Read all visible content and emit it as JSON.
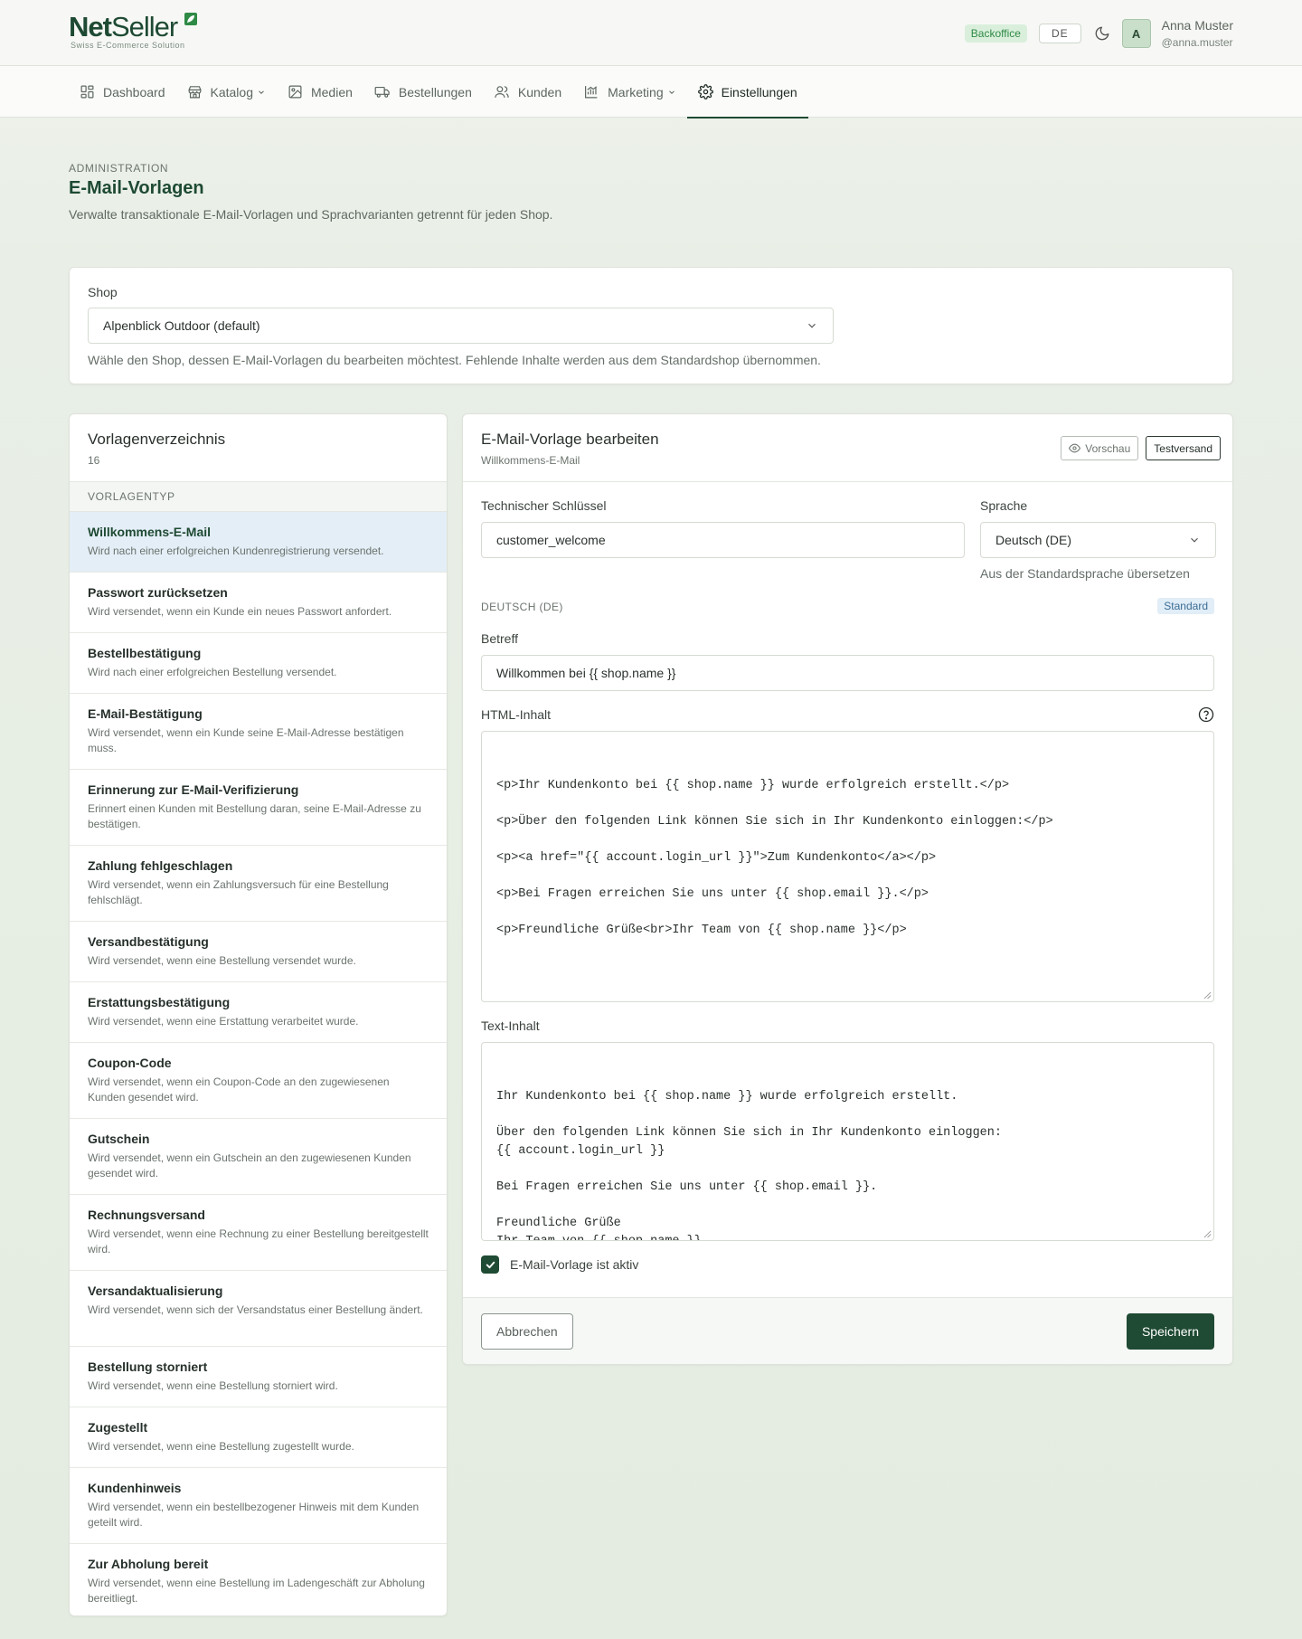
{
  "brand": {
    "name_bold": "Net",
    "name_light": "Seller",
    "tagline": "Swiss E-Commerce Solution"
  },
  "header": {
    "badge": "Backoffice",
    "language": "DE",
    "user": {
      "initial": "A",
      "name": "Anna Muster",
      "handle": "@anna.muster"
    }
  },
  "nav": {
    "items": [
      {
        "label": "Dashboard",
        "icon": "dashboard-icon",
        "dropdown": false,
        "active": false
      },
      {
        "label": "Katalog",
        "icon": "store-icon",
        "dropdown": true,
        "active": false
      },
      {
        "label": "Medien",
        "icon": "image-icon",
        "dropdown": false,
        "active": false
      },
      {
        "label": "Bestellungen",
        "icon": "truck-icon",
        "dropdown": false,
        "active": false
      },
      {
        "label": "Kunden",
        "icon": "users-icon",
        "dropdown": false,
        "active": false
      },
      {
        "label": "Marketing",
        "icon": "chart-icon",
        "dropdown": true,
        "active": false
      },
      {
        "label": "Einstellungen",
        "icon": "gear-icon",
        "dropdown": false,
        "active": true
      }
    ]
  },
  "page": {
    "eyebrow": "ADMINISTRATION",
    "title": "E-Mail-Vorlagen",
    "description": "Verwalte transaktionale E-Mail-Vorlagen und Sprachvarianten getrennt für jeden Shop."
  },
  "shop": {
    "label": "Shop",
    "value": "Alpenblick Outdoor (default)",
    "help": "Wähle den Shop, dessen E-Mail-Vorlagen du bearbeiten möchtest. Fehlende Inhalte werden aus dem Standardshop übernommen."
  },
  "templates": {
    "title": "Vorlagenverzeichnis",
    "count": "16",
    "column": "VORLAGENTYP",
    "items": [
      {
        "name": "Willkommens-E-Mail",
        "desc": "Wird nach einer erfolgreichen Kundenregistrierung versendet.",
        "active": true
      },
      {
        "name": "Passwort zurücksetzen",
        "desc": "Wird versendet, wenn ein Kunde ein neues Passwort anfordert.",
        "active": false
      },
      {
        "name": "Bestellbestätigung",
        "desc": "Wird nach einer erfolgreichen Bestellung versendet.",
        "active": false
      },
      {
        "name": "E-Mail-Bestätigung",
        "desc": "Wird versendet, wenn ein Kunde seine E-Mail-Adresse bestätigen muss.",
        "active": false
      },
      {
        "name": "Erinnerung zur E-Mail-Verifizierung",
        "desc": "Erinnert einen Kunden mit Bestellung daran, seine E-Mail-Adresse zu bestätigen.",
        "active": false
      },
      {
        "name": "Zahlung fehlgeschlagen",
        "desc": "Wird versendet, wenn ein Zahlungsversuch für eine Bestellung fehlschlägt.",
        "active": false
      },
      {
        "name": "Versandbestätigung",
        "desc": "Wird versendet, wenn eine Bestellung versendet wurde.",
        "active": false
      },
      {
        "name": "Erstattungsbestätigung",
        "desc": "Wird versendet, wenn eine Erstattung verarbeitet wurde.",
        "active": false
      },
      {
        "name": "Coupon-Code",
        "desc": "Wird versendet, wenn ein Coupon-Code an den zugewiesenen Kunden gesendet wird.",
        "active": false
      },
      {
        "name": "Gutschein",
        "desc": "Wird versendet, wenn ein Gutschein an den zugewiesenen Kunden gesendet wird.",
        "active": false
      },
      {
        "name": "Rechnungsversand",
        "desc": "Wird versendet, wenn eine Rechnung zu einer Bestellung bereitgestellt wird.",
        "active": false
      },
      {
        "name": "Versandaktualisierung",
        "desc": "Wird versendet, wenn sich der Versandstatus einer Bestellung ändert.",
        "active": false
      },
      {
        "name": "Bestellung storniert",
        "desc": "Wird versendet, wenn eine Bestellung storniert wird.",
        "active": false
      },
      {
        "name": "Zugestellt",
        "desc": "Wird versendet, wenn eine Bestellung zugestellt wurde.",
        "active": false
      },
      {
        "name": "Kundenhinweis",
        "desc": "Wird versendet, wenn ein bestellbezogener Hinweis mit dem Kunden geteilt wird.",
        "active": false
      },
      {
        "name": "Zur Abholung bereit",
        "desc": "Wird versendet, wenn eine Bestellung im Ladengeschäft zur Abholung bereitliegt.",
        "active": false
      }
    ]
  },
  "editor": {
    "title": "E-Mail-Vorlage bearbeiten",
    "subtitle": "Willkommens-E-Mail",
    "preview_label": "Vorschau",
    "test_label": "Testversand",
    "key_label": "Technischer Schlüssel",
    "key_value": "customer_welcome",
    "lang_label": "Sprache",
    "lang_value": "Deutsch (DE)",
    "translate_link": "Aus der Standardsprache übersetzen",
    "section_label": "DEUTSCH (DE)",
    "section_badge": "Standard",
    "subject_label": "Betreff",
    "subject_value": "Willkommen bei {{ shop.name }}",
    "html_label": "HTML-Inhalt",
    "html_value": "<p>Ihr Kundenkonto bei {{ shop.name }} wurde erfolgreich erstellt.</p>\n\n<p>Über den folgenden Link können Sie sich in Ihr Kundenkonto einloggen:</p>\n\n<p><a href=\"{{ account.login_url }}\">Zum Kundenkonto</a></p>\n\n<p>Bei Fragen erreichen Sie uns unter {{ shop.email }}.</p>\n\n<p>Freundliche Grüße<br>Ihr Team von {{ shop.name }}</p>",
    "text_label": "Text-Inhalt",
    "text_value": "Ihr Kundenkonto bei {{ shop.name }} wurde erfolgreich erstellt.\n\nÜber den folgenden Link können Sie sich in Ihr Kundenkonto einloggen:\n{{ account.login_url }}\n\nBei Fragen erreichen Sie uns unter {{ shop.email }}.\n\nFreundliche Grüße\nIhr Team von {{ shop.name }}",
    "active_label": "E-Mail-Vorlage ist aktiv",
    "active_checked": true,
    "cancel_label": "Abbrechen",
    "save_label": "Speichern"
  },
  "colors": {
    "brand": "#1f4a33",
    "active_row": "#e4eef7",
    "badge_green": "#d9efdc"
  }
}
